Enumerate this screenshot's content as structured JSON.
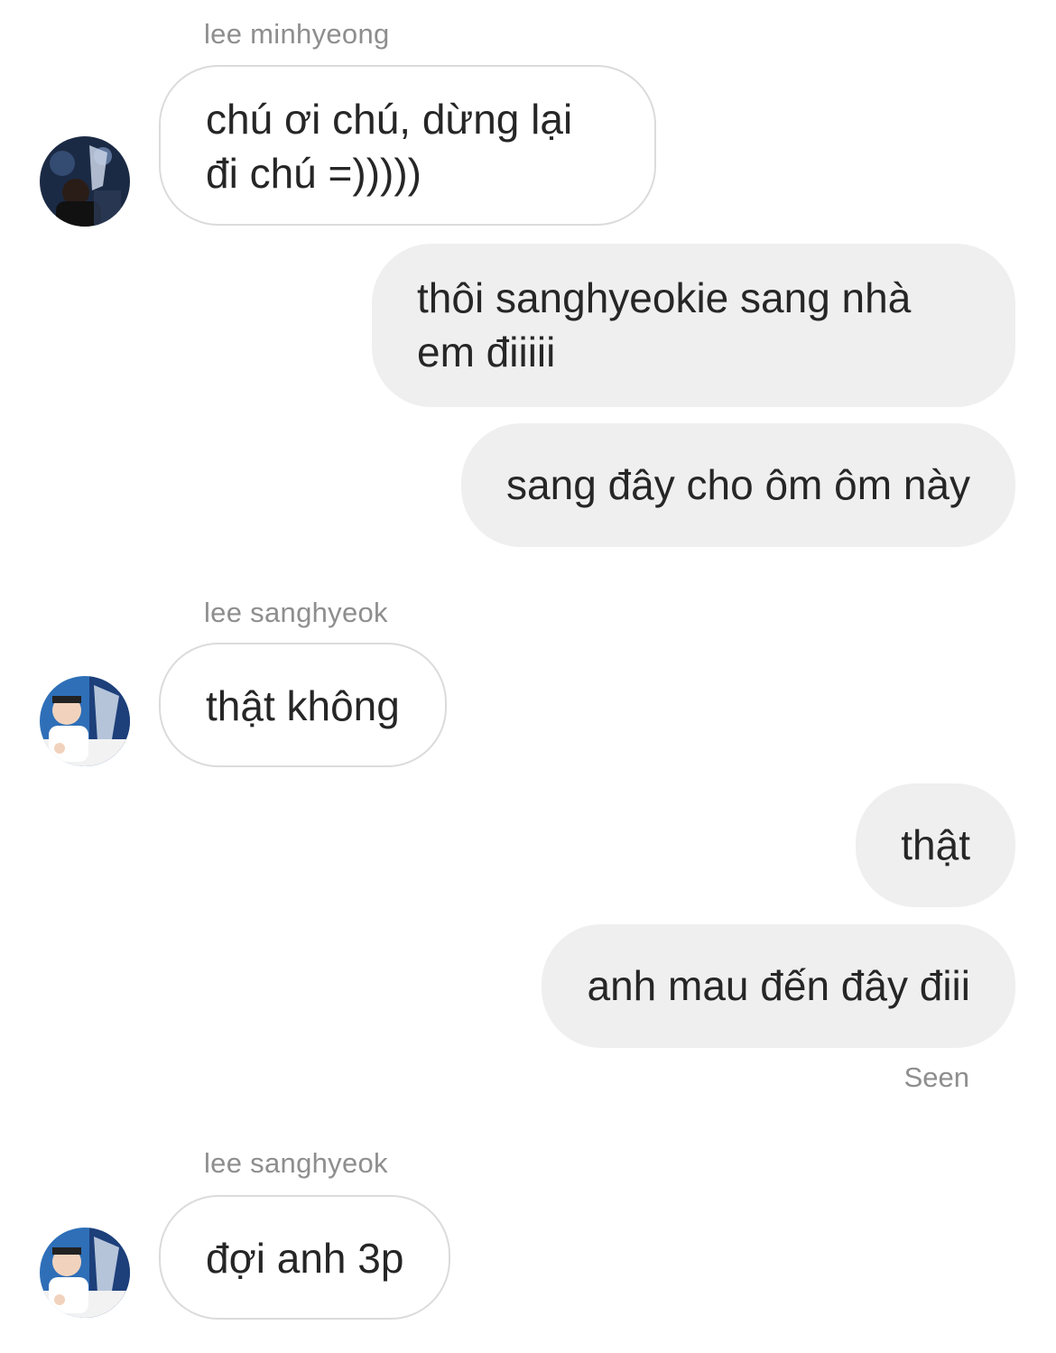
{
  "messages": [
    {
      "sender": "lee minhyeong",
      "text": "chú ơi chú, dừng lại đi chú =)))))"
    },
    {
      "text": "thôi sanghyeokie sang nhà em điiiii"
    },
    {
      "text": "sang đây cho ôm ôm này"
    },
    {
      "sender": "lee sanghyeok",
      "text": "thật không"
    },
    {
      "text": "thật"
    },
    {
      "text": "anh mau đến đây điii"
    },
    {
      "sender": "lee sanghyeok",
      "text": "đợi anh 3p"
    }
  ],
  "status": {
    "seen_label": "Seen"
  },
  "icons": {
    "avatar_1": "user-avatar-icon",
    "avatar_2": "user-avatar-icon",
    "avatar_3": "user-avatar-icon"
  },
  "colors": {
    "outgoing_bubble": "#efefef",
    "incoming_border": "#dbdbdb",
    "secondary_text": "#8e8e8e",
    "primary_text": "#262626"
  }
}
